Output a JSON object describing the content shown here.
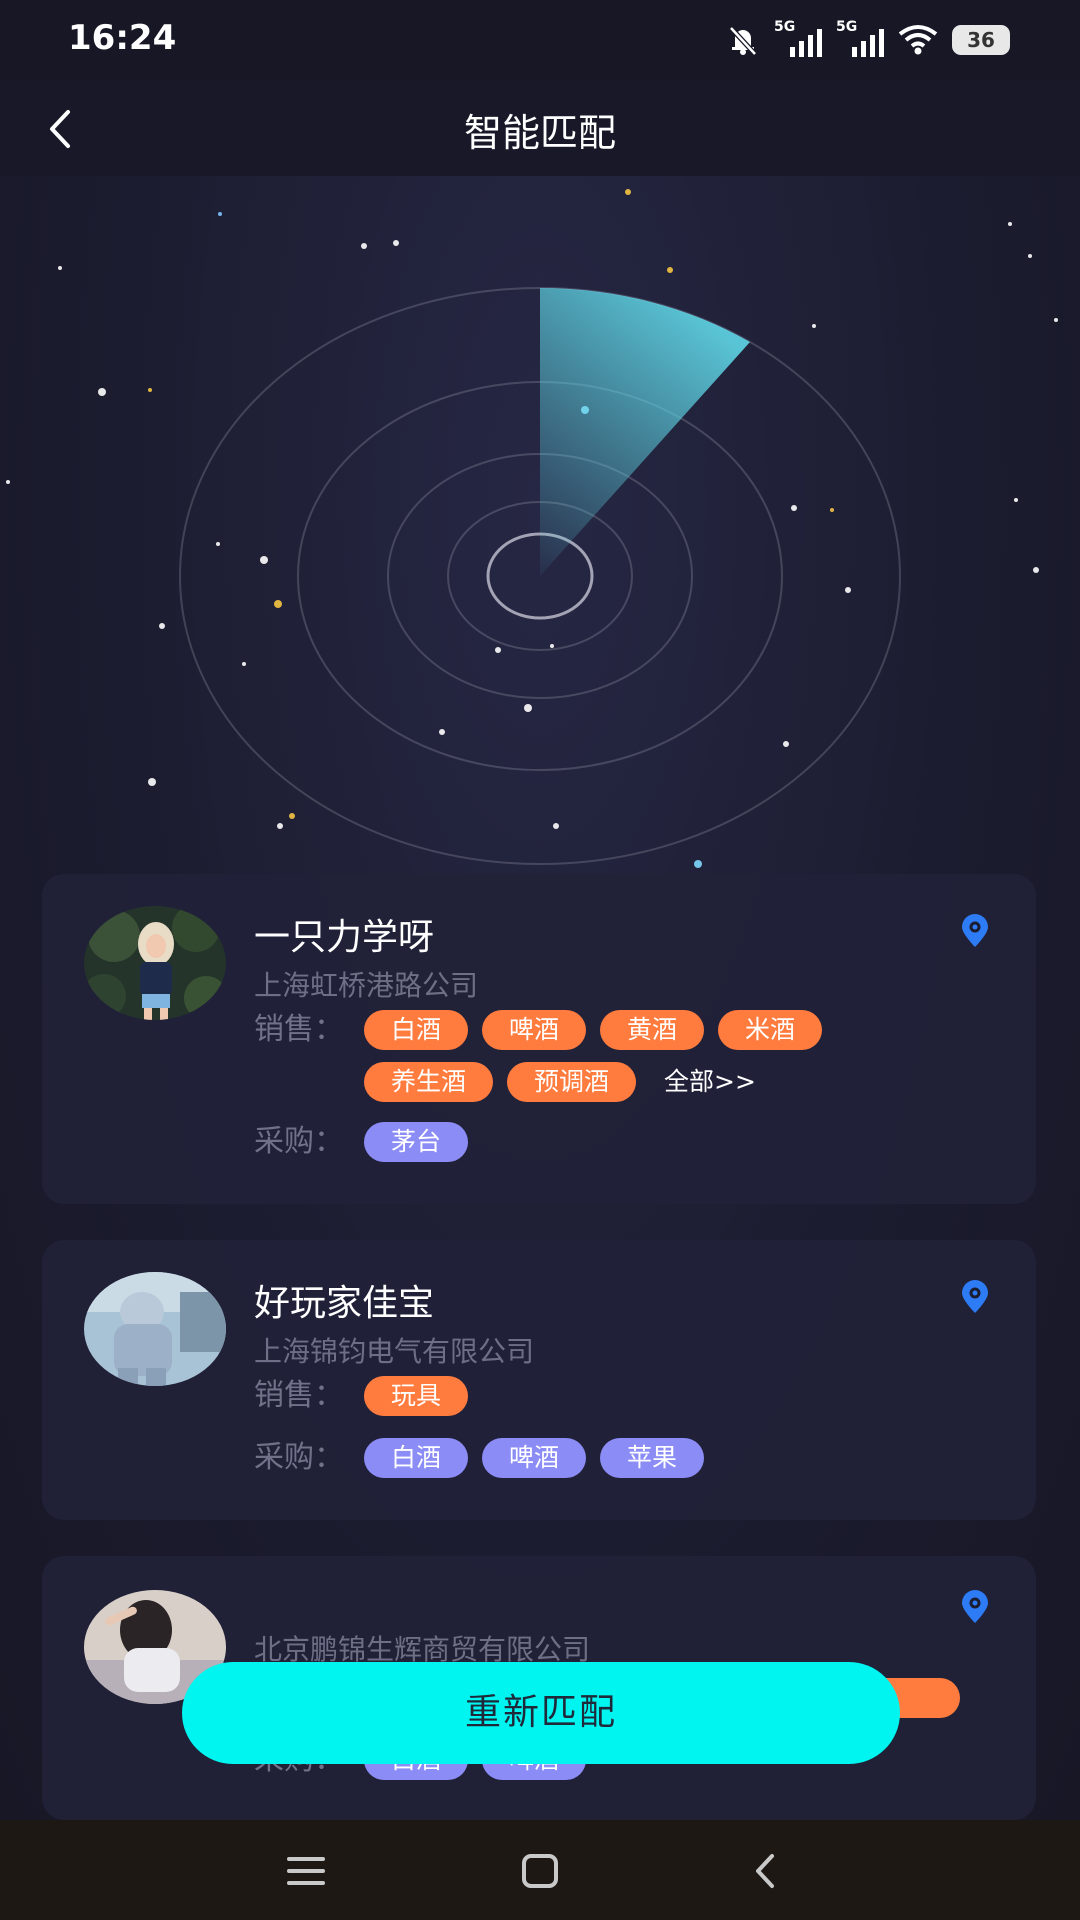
{
  "status_bar": {
    "time": "16:24",
    "battery": "36",
    "network": [
      "5G",
      "5G"
    ]
  },
  "header": {
    "title": "智能匹配",
    "back_icon": "chevron-left-icon"
  },
  "labels": {
    "sell": "销售：",
    "buy": "采购：",
    "all_link": "全部>>"
  },
  "matches": [
    {
      "name": "一只力学呀",
      "company": "上海虹桥港路公司",
      "sell_tags": [
        "白酒",
        "啤酒",
        "黄酒",
        "米酒",
        "养生酒",
        "预调酒"
      ],
      "buy_tags": [
        "茅台"
      ]
    },
    {
      "name": "好玩家佳宝",
      "company": "上海锦钧电气有限公司",
      "sell_tags": [
        "玩具"
      ],
      "buy_tags": [
        "白酒",
        "啤酒",
        "苹果"
      ]
    },
    {
      "name": "",
      "company": "北京鹏锦生辉商贸有限公司",
      "sell_tags": [],
      "buy_tags": [
        "白酒",
        "啤酒"
      ]
    }
  ],
  "actions": {
    "rematch": "重新匹配"
  },
  "system_nav": {
    "menu": "menu-icon",
    "home": "home-icon",
    "back": "back-icon"
  },
  "colors": {
    "sell_tag": "#ff7c3e",
    "buy_tag": "#8b8cf6",
    "rematch_button": "#00f5f0",
    "location_pin": "#2d7cf6"
  }
}
